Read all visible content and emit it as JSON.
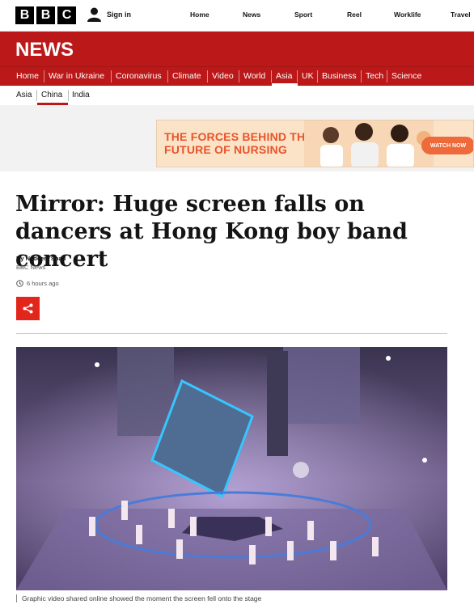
{
  "topbar": {
    "logo_letters": [
      "B",
      "B",
      "C"
    ],
    "signin_label": "Sign in",
    "nav": [
      "Home",
      "News",
      "Sport",
      "Reel",
      "Worklife",
      "Travel"
    ]
  },
  "news": {
    "title": "NEWS",
    "nav": [
      "Home",
      "War in Ukraine",
      "Coronavirus",
      "Climate",
      "Video",
      "World",
      "Asia",
      "UK",
      "Business",
      "Tech",
      "Science"
    ],
    "active": "Asia"
  },
  "subnav": {
    "items": [
      "Asia",
      "China",
      "India"
    ],
    "active": "China"
  },
  "ad": {
    "line1": "THE FORCES BEHIND THE",
    "line2": "FUTURE OF NURSING",
    "button": "WATCH NOW"
  },
  "article": {
    "headline": "Mirror: Huge screen falls on dancers at Hong Kong boy band concert",
    "author": "By Nadeem Shad",
    "organization": "BBC News",
    "timestamp": "6 hours ago",
    "caption": "Graphic video shared online showed the moment the screen fell onto the stage"
  },
  "colors": {
    "brand_red": "#bb1919",
    "share_red": "#e3261c",
    "ad_orange": "#e8542a"
  }
}
